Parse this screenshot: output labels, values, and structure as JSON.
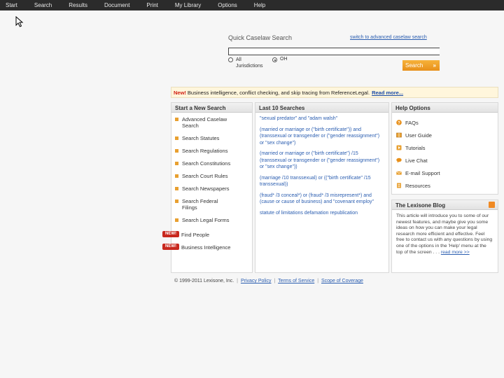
{
  "nav": {
    "items": [
      "Start",
      "Search",
      "Results",
      "Document",
      "Print",
      "My Library",
      "Options",
      "Help"
    ]
  },
  "quick_search": {
    "title": "Quick Caselaw Search",
    "advanced_link": "switch to advanced caselaw search",
    "input_value": "",
    "radio_all_label": "All Jurisdictions",
    "radio_oh_label": "OH",
    "selected": "OH",
    "button_label": "Search",
    "button_arrow": "»"
  },
  "banner": {
    "new_label": "New!",
    "text": "Business intelligence, conflict checking, and skip tracing from ReferenceLegal.",
    "more_link": "Read more..."
  },
  "start_new_search": {
    "heading": "Start a New Search",
    "items": [
      "Advanced Caselaw Search",
      "Search Statutes",
      "Search Regulations",
      "Search Constitutions",
      "Search Court Rules",
      "Search Newspapers",
      "Search Federal Filings",
      "Search Legal Forms"
    ],
    "new_items": [
      "Find People",
      "Business Intelligence"
    ],
    "new_badge": "NEW!"
  },
  "last_searches": {
    "heading": "Last 10 Searches",
    "items": [
      "\"sexual predator\" and \"adam walsh\"",
      "(married or marriage or (\"birth certificate\")) and (transsexual or transgender or (\"gender reassignment\") or \"sex change\")",
      "(married or marriage or (\"birth certificate\") /15 (transsexual or transgender or (\"gender reassignment\") or \"sex change\"))",
      "(marriage /10 transsexual) or ((\"birth certificate\" /15 transsexual))",
      "(fraud* /3 conceal*) or (fraud* /3 misrepresent*) and (cause or cause of business) and \"covenant employ\"",
      "statute of limitations defamation republication"
    ]
  },
  "help_options": {
    "heading": "Help Options",
    "items": [
      {
        "label": "FAQs",
        "icon": "question-icon"
      },
      {
        "label": "User Guide",
        "icon": "book-icon"
      },
      {
        "label": "Tutorials",
        "icon": "play-icon"
      },
      {
        "label": "Live Chat",
        "icon": "chat-icon"
      },
      {
        "label": "E-mail Support",
        "icon": "mail-icon"
      },
      {
        "label": "Resources",
        "icon": "document-icon"
      }
    ]
  },
  "blog": {
    "heading": "The Lexisone Blog",
    "text": "This article will introduce you to some of our newest features, and maybe give you some ideas on how you can make your legal research more efficient and effective. Feel free to contact us with any questions by using one of the options in the 'Help' menu at the top of the screen . . .",
    "more": "read more >>"
  },
  "footer": {
    "copyright": "© 1999-2011 Lexisone, Inc.",
    "links": [
      "Privacy Policy",
      "Terms of Service",
      "Scope of Coverage"
    ]
  },
  "colors": {
    "nav_bg": "#2b2b2b",
    "accent_orange": "#e8901a",
    "link_blue": "#2a5db0",
    "new_red": "#c8281e"
  }
}
